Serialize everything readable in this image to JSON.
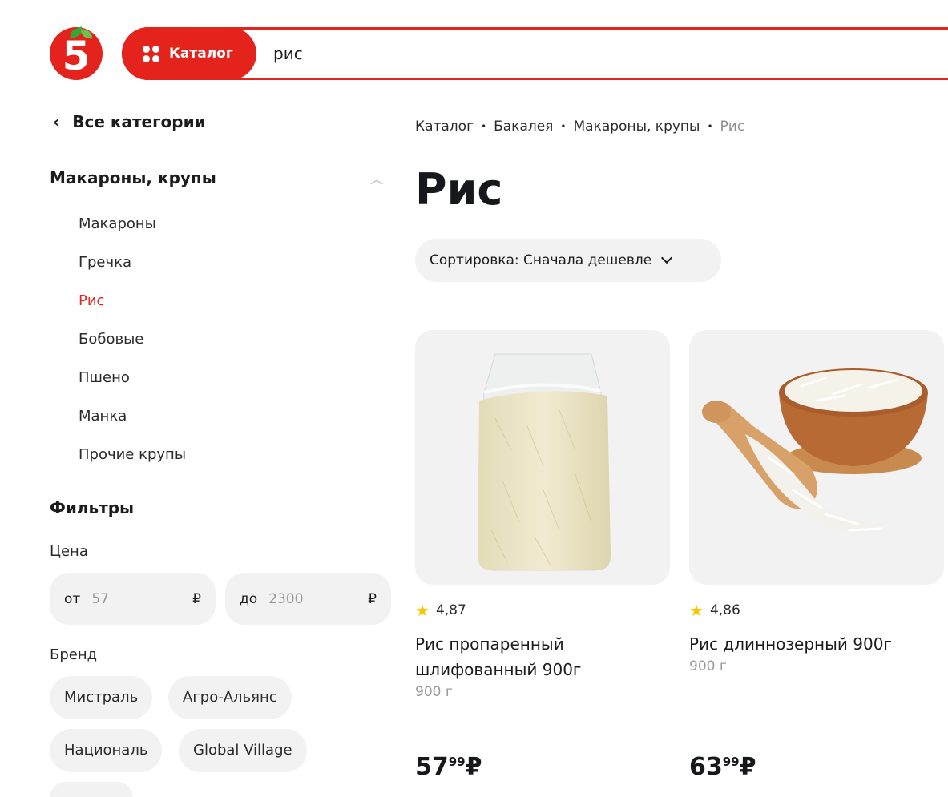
{
  "header": {
    "logo_text": "5",
    "catalog_label": "Каталог",
    "search_value": "рис"
  },
  "sidebar": {
    "back_label": "Все категории",
    "category_title": "Макароны, крупы",
    "subcategories": [
      {
        "label": "Макароны",
        "active": false
      },
      {
        "label": "Гречка",
        "active": false
      },
      {
        "label": "Рис",
        "active": true
      },
      {
        "label": "Бобовые",
        "active": false
      },
      {
        "label": "Пшено",
        "active": false
      },
      {
        "label": "Манка",
        "active": false
      },
      {
        "label": "Прочие крупы",
        "active": false
      }
    ],
    "filters_title": "Фильтры",
    "price": {
      "label": "Цена",
      "from_prefix": "от",
      "from_value": "57",
      "to_prefix": "до",
      "to_value": "2300",
      "currency": "₽"
    },
    "brand": {
      "label": "Бренд",
      "chips": [
        "Мистраль",
        "Агро-Альянс",
        "Националь",
        "Global Village"
      ]
    }
  },
  "main": {
    "breadcrumbs": [
      "Каталог",
      "Бакалея",
      "Макароны, крупы",
      "Рис"
    ],
    "title": "Рис",
    "sort_label": "Сортировка: Сначала дешевле",
    "products": [
      {
        "rating": "4,87",
        "name": "Рис пропаренный шлифованный 900г",
        "weight": "900 г",
        "price_int": "57",
        "price_frac": "99",
        "currency": "₽"
      },
      {
        "rating": "4,86",
        "name": "Рис длиннозерный 900г",
        "weight": "900 г",
        "price_int": "63",
        "price_frac": "99",
        "currency": "₽"
      }
    ]
  },
  "colors": {
    "brand_red": "#e3231c",
    "chip_bg": "#f2f2f2",
    "star": "#f7c600",
    "leaf_green": "#3aa536"
  }
}
